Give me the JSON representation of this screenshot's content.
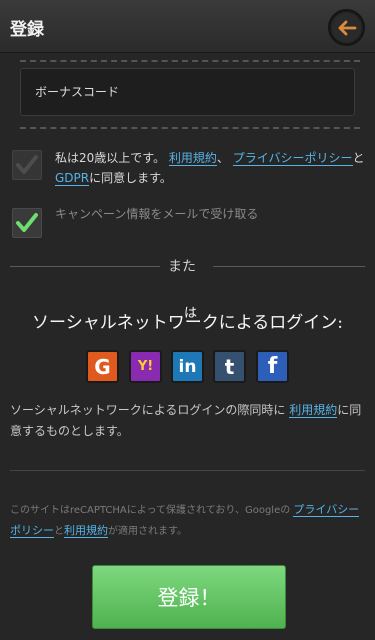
{
  "header": {
    "title": "登録"
  },
  "form": {
    "bonus_placeholder": "ボーナスコード",
    "terms": {
      "prefix": "私は20歳以上です。",
      "terms_link": "利用規約",
      "sep": "、",
      "privacy_link": "プライバシーポリシー",
      "and": "と",
      "gdpr_link": "GDPR",
      "suffix": "に同意します。",
      "checked": true
    },
    "campaign": {
      "label": "キャンペーン情報をメールで受け取る",
      "checked": true
    }
  },
  "or_label": "また",
  "social": {
    "title": "ソーシャルネットワークによるログイン:",
    "stray_char": "は",
    "buttons": [
      {
        "name": "google",
        "glyph": "G",
        "color": "#e05a20"
      },
      {
        "name": "yahoo",
        "glyph": "Y!",
        "color": "#8a2ab0"
      },
      {
        "name": "linkedin",
        "glyph": "in",
        "color": "#1d78b5"
      },
      {
        "name": "tumblr",
        "glyph": "t",
        "color": "#36506f"
      },
      {
        "name": "facebook",
        "glyph": "f",
        "color": "#2d5fb8"
      }
    ],
    "note_prefix": "ソーシャルネットワークによるログインの際同時に",
    "note_link": "利用規約",
    "note_suffix": "に同意するものとします。"
  },
  "captcha": {
    "prefix": "このサイトはreCAPTCHAによって保護されており、Googleの",
    "privacy_link": "プライバシーポリシー",
    "and": "と",
    "terms_link": "利用規約",
    "suffix": "が適用されます。"
  },
  "submit_label": "登録！",
  "colors": {
    "link": "#55b4e6",
    "submit": "#5fc05f",
    "check": "#6fdc6f"
  }
}
